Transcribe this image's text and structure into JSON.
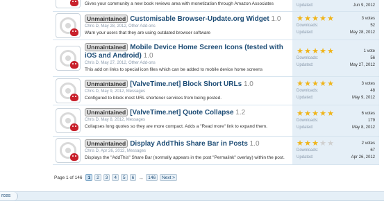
{
  "rows": [
    {
      "description": "Gives your community a new book reviews area with monetization through Amazon Associates",
      "updated_label": "Updated:",
      "updated": "Jun 9, 2012"
    },
    {
      "badge": "Unmaintained",
      "title": "Customisable Browser-Update.org Widget",
      "version": "1.0",
      "meta": "Chris D, May 28, 2012, Other Add-ons",
      "description": "Warn your users that they are using outdated browser software",
      "votes": "3 votes",
      "downloads_label": "Downloads:",
      "downloads": "52",
      "updated_label": "Updated:",
      "updated": "May 28, 2012",
      "rating": 5
    },
    {
      "badge": "Unmaintained",
      "title": "Mobile Device Home Screen Icons (tested with iOS and Android)",
      "version": "1.0",
      "meta": "Chris D, May 27, 2012, Other Add-ons",
      "description": "This add on links to special icon files which can be added to mobile device home screens",
      "votes": "1 vote",
      "downloads_label": "Downloads:",
      "downloads": "56",
      "updated_label": "Updated:",
      "updated": "May 27, 2012",
      "rating": 5
    },
    {
      "badge": "Unmaintained",
      "title": "[ValveTime.net] Block Short URLs",
      "version": "1.0",
      "meta": "Chris D, May 9, 2012, Messages",
      "description": "Configured to block most URL shortener services from being posted.",
      "votes": "3 votes",
      "downloads_label": "Downloads:",
      "downloads": "48",
      "updated_label": "Updated:",
      "updated": "May 9, 2012",
      "rating": 5
    },
    {
      "badge": "Unmaintained",
      "title": "[ValveTime.net] Quote Collapse",
      "version": "1.2",
      "meta": "Chris D, May 8, 2012, Messages",
      "description": "Collapses long quotes so they are more compact. Adds a \"Read more\" link to expand them.",
      "votes": "6 votes",
      "downloads_label": "Downloads:",
      "downloads": "179",
      "updated_label": "Updated:",
      "updated": "May 8, 2012",
      "rating": 5
    },
    {
      "badge": "Unmaintained",
      "title": "Display AddThis Share Bar in Posts",
      "version": "1.0",
      "meta": "Chris D, Apr 26, 2012, Messages",
      "description": "Displays the \"AddThis\" Share Bar (normally appears in the post \"Permalink\" overlay) within the post.",
      "votes": "2 votes",
      "downloads_label": "Downloads:",
      "downloads": "67",
      "updated_label": "Updated:",
      "updated": "Apr 26, 2012",
      "rating": 3
    }
  ],
  "pagination": {
    "label": "Page 1 of 146",
    "pages": [
      "1",
      "2",
      "3",
      "4",
      "5",
      "6"
    ],
    "arrow": "→",
    "last": "146",
    "next": "Next >"
  },
  "footer": {
    "breadcrumb": "rces"
  },
  "colors": {
    "star": "#f0b418",
    "link": "#1e4d76",
    "sidebar": "#e5eff7"
  }
}
